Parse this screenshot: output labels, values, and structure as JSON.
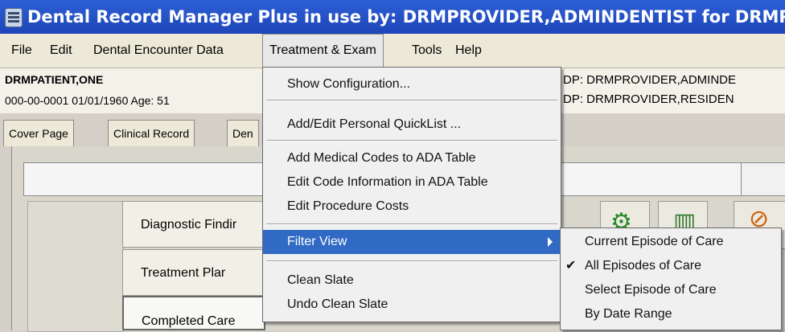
{
  "window": {
    "title": "Dental Record Manager Plus in use by: DRMPROVIDER,ADMINDENTIST for DRMPATIENT"
  },
  "menubar": [
    "File",
    "Edit",
    "Dental Encounter Data",
    "Treatment & Exam",
    "Tools",
    "Help"
  ],
  "patient": {
    "name": "DRMPATIENT,ONE",
    "info": "000-00-0001   01/01/1960 Age: 51",
    "dp1": "DP: DRMPROVIDER,ADMINDE",
    "dp2": "DP: DRMPROVIDER,RESIDEN"
  },
  "tabs": [
    "Cover Page",
    "Clinical Record",
    "Den"
  ],
  "care_buttons": [
    "Diagnostic Findir",
    "Treatment Plar",
    "Completed Care"
  ],
  "menu": {
    "items": [
      "Show Configuration...",
      "Add/Edit Personal QuickList ...",
      "Add Medical Codes to ADA Table",
      "Edit Code Information in ADA Table",
      "Edit Procedure Costs",
      "Filter View",
      "Clean Slate",
      "Undo Clean Slate"
    ]
  },
  "submenu": {
    "items": [
      "Current Episode of Care",
      "All Episodes of Care",
      "Select Episode of Care",
      "By Date Range"
    ],
    "checked": "All Episodes of Care",
    "check_mark": "✔"
  },
  "colors": {
    "title_bar": "#2455c8",
    "highlight": "#316ac5"
  }
}
